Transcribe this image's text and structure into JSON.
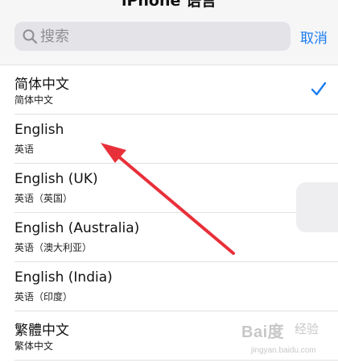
{
  "header": {
    "title": "iPhone 语言",
    "search_placeholder": "搜索",
    "cancel_label": "取消"
  },
  "languages": [
    {
      "title": "简体中文",
      "subtitle": "简体中文",
      "selected": true
    },
    {
      "title": "English",
      "subtitle": "英语",
      "selected": false
    },
    {
      "title": "English (UK)",
      "subtitle": "英语（英国）",
      "selected": false
    },
    {
      "title": "English (Australia)",
      "subtitle": "英语（澳大利亚）",
      "selected": false
    },
    {
      "title": "English (India)",
      "subtitle": "英语（印度）",
      "selected": false
    },
    {
      "title": "繁體中文",
      "subtitle": "繁体中文",
      "selected": false
    }
  ],
  "watermark": {
    "logo": "Bai度",
    "text": "经验",
    "url": "jingyan.baidu.com"
  },
  "colors": {
    "accent": "#1a7cf0",
    "arrow": "#e8303a"
  },
  "icons": {
    "search": "magnifier-icon",
    "selected": "checkmark-icon"
  }
}
